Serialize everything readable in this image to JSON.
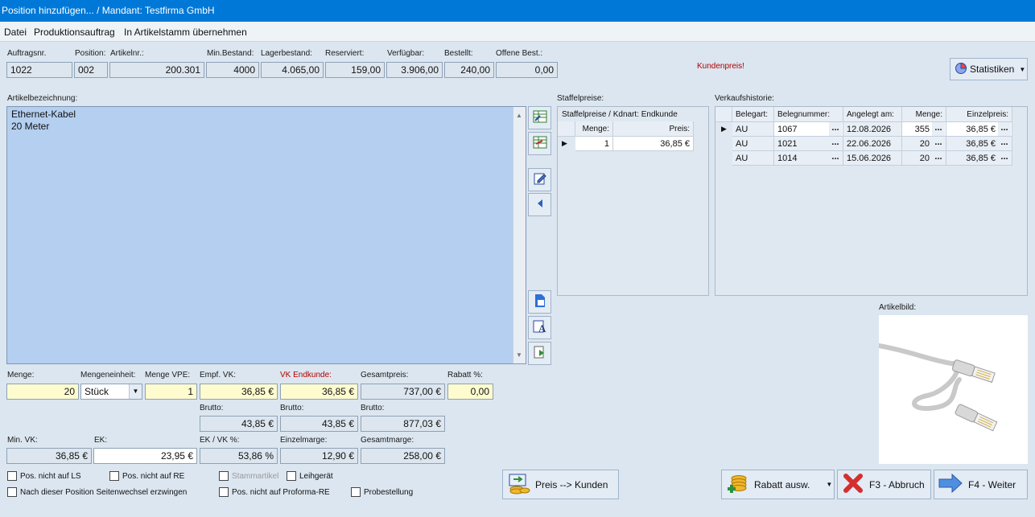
{
  "window": {
    "title": "Position hinzufügen... / Mandant: Testfirma GmbH"
  },
  "menu": [
    "Datei",
    "Produktionsauftrag",
    "In Artikelstamm übernehmen"
  ],
  "header": {
    "labels": {
      "auftragsnr": "Auftragsnr.",
      "position": "Position:",
      "artikelnr": "Artikelnr.:",
      "min_bestand": "Min.Bestand:",
      "lagerbestand": "Lagerbestand:",
      "reserviert": "Reserviert:",
      "verfuegbar": "Verfügbar:",
      "bestellt": "Bestellt:",
      "offene_best": "Offene Best.:"
    },
    "values": {
      "auftragsnr": "1022",
      "position": "002",
      "artikelnr": "200.301",
      "min_bestand": "4000",
      "lagerbestand": "4.065,00",
      "reserviert": "159,00",
      "verfuegbar": "3.906,00",
      "bestellt": "240,00",
      "offene_best": "0,00"
    },
    "kundenpreis": "Kundenpreis!",
    "statistiken": "Statistiken"
  },
  "article": {
    "label": "Artikelbezeichnung:",
    "line1": "Ethernet-Kabel",
    "line2": "20 Meter"
  },
  "staffel": {
    "label": "Staffelpreise:",
    "subtitle": "Staffelpreise / Kdnart: Endkunde",
    "col_menge": "Menge:",
    "col_preis": "Preis:",
    "rows": [
      {
        "menge": "1",
        "preis": "36,85 €"
      }
    ]
  },
  "historie": {
    "label": "Verkaufshistorie:",
    "cols": [
      "Belegart:",
      "Belegnummer:",
      "Angelegt am:",
      "Menge:",
      "Einzelpreis:"
    ],
    "rows": [
      {
        "belegart": "AU",
        "nummer": "1067",
        "datum": "12.08.2026",
        "menge": "355",
        "preis": "36,85 €"
      },
      {
        "belegart": "AU",
        "nummer": "1021",
        "datum": "22.06.2026",
        "menge": "20",
        "preis": "36,85 €"
      },
      {
        "belegart": "AU",
        "nummer": "1014",
        "datum": "15.06.2026",
        "menge": "20",
        "preis": "36,85 €"
      }
    ],
    "dots": "..."
  },
  "artikelbild": {
    "label": "Artikelbild:"
  },
  "pricing": {
    "labels": {
      "menge": "Menge:",
      "mengeneinheit": "Mengeneinheit:",
      "menge_vpe": "Menge VPE:",
      "empf_vk": "Empf. VK:",
      "vk_endkunde": "VK Endkunde:",
      "gesamtpreis": "Gesamtpreis:",
      "rabatt": "Rabatt %:",
      "brutto": "Brutto:",
      "min_vk": "Min. VK:",
      "ek": "EK:",
      "ek_vk": "EK / VK %:",
      "einzelmarge": "Einzelmarge:",
      "gesamtmarge": "Gesamtmarge:"
    },
    "values": {
      "menge": "20",
      "mengeneinheit": "Stück",
      "menge_vpe": "1",
      "empf_vk": "36,85 €",
      "vk_endkunde": "36,85 €",
      "gesamtpreis": "737,00 €",
      "rabatt": "0,00",
      "brutto_empf": "43,85 €",
      "brutto_vk": "43,85 €",
      "brutto_gesamt": "877,03 €",
      "min_vk": "36,85 €",
      "ek": "23,95 €",
      "ek_vk": "53,86 %",
      "einzelmarge": "12,90 €",
      "gesamtmarge": "258,00 €"
    }
  },
  "checkboxes": {
    "ls": "Pos. nicht auf LS",
    "re": "Pos. nicht auf RE",
    "stammartikel": "Stammartikel",
    "leihgeraet": "Leihgerät",
    "seitenwechsel": "Nach dieser Position Seitenwechsel erzwingen",
    "proforma": "Pos. nicht auf Proforma-RE",
    "probestellung": "Probestellung"
  },
  "buttons": {
    "preis_kunden": "Preis --> Kunden",
    "rabatt": "Rabatt ausw.",
    "abbruch": "F3 - Abbruch",
    "weiter": "F4 - Weiter"
  },
  "colors": {
    "titlebar": "#0078d7",
    "textarea": "#b4cff0",
    "yellow_field": "#fefccf"
  }
}
